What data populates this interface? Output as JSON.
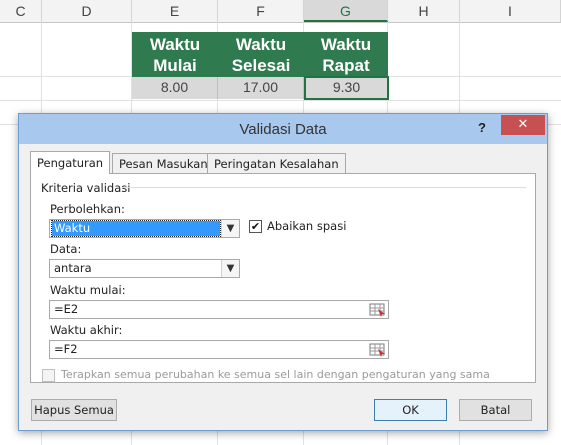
{
  "sheet": {
    "columns": [
      "C",
      "D",
      "E",
      "F",
      "G",
      "H",
      "I"
    ],
    "headers": {
      "e": [
        "Waktu",
        "Mulai"
      ],
      "f": [
        "Waktu",
        "Selesai"
      ],
      "g": [
        "Waktu",
        "Rapat"
      ]
    },
    "values": {
      "e": "8.00",
      "f": "17.00",
      "g": "9.30"
    }
  },
  "dialog": {
    "title": "Validasi Data",
    "help_label": "?",
    "close_label": "✕",
    "tabs": [
      "Pengaturan",
      "Pesan Masukan",
      "Peringatan Kesalahan"
    ],
    "group_label": "Kriteria validasi",
    "allow_label": "Perbolehkan:",
    "allow_value": "Waktu",
    "ignore_blank_label": "Abaikan spasi",
    "ignore_blank_checked": "✔",
    "data_label": "Data:",
    "data_value": "antara",
    "start_label": "Waktu mulai:",
    "start_value": "=E2",
    "end_label": "Waktu akhir:",
    "end_value": "=F2",
    "apply_all_label": "Terapkan semua perubahan ke semua sel lain dengan pengaturan yang sama",
    "clear_all_button": "Hapus Semua",
    "ok_button": "OK",
    "cancel_button": "Batal"
  },
  "colors": {
    "header_green": "#2f7a4e",
    "titlebar_blue": "#a8c8ee",
    "close_red": "#c75050",
    "selection_blue": "#3399ff"
  }
}
